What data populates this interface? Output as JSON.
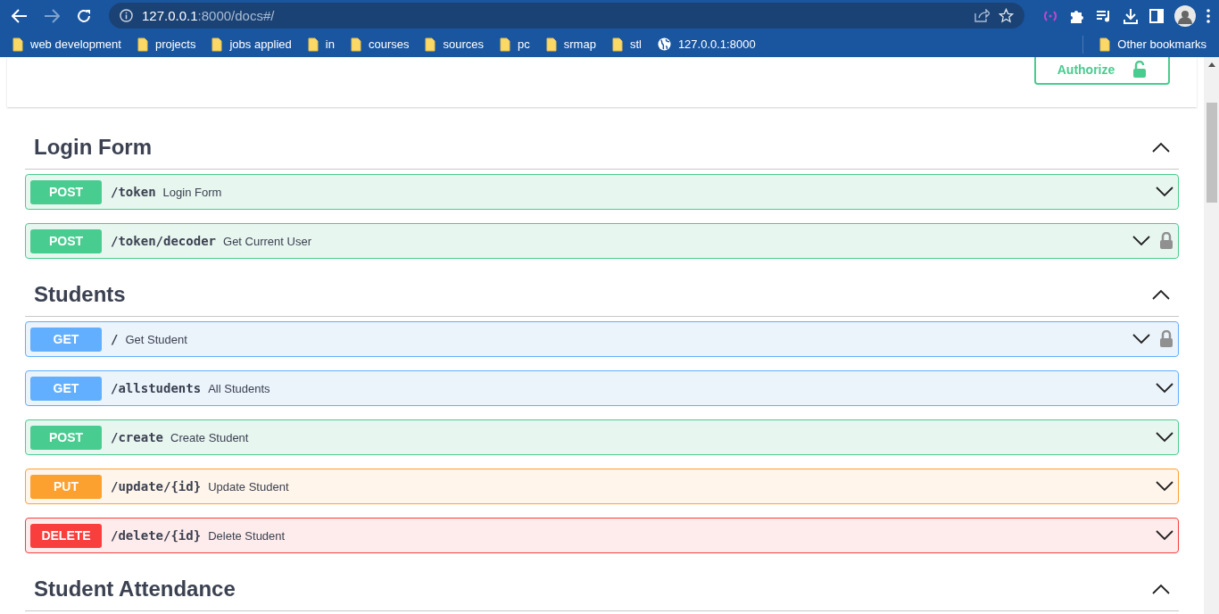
{
  "browser": {
    "address": {
      "host": "127.0.0.1",
      "rest": ":8000/docs#/"
    },
    "bookmarks": [
      {
        "kind": "folder",
        "label": "web development"
      },
      {
        "kind": "folder",
        "label": "projects"
      },
      {
        "kind": "folder",
        "label": "jobs applied"
      },
      {
        "kind": "folder",
        "label": "in"
      },
      {
        "kind": "folder",
        "label": "courses"
      },
      {
        "kind": "folder",
        "label": "sources"
      },
      {
        "kind": "folder",
        "label": "pc"
      },
      {
        "kind": "folder",
        "label": "srmap"
      },
      {
        "kind": "folder",
        "label": "stl"
      },
      {
        "kind": "site",
        "label": "127.0.0.1:8000"
      }
    ],
    "other_bookmarks": "Other bookmarks"
  },
  "authorize_button": {
    "label": "Authorize",
    "locked": false
  },
  "sections": [
    {
      "name": "Login Form",
      "expanded": true,
      "operations": [
        {
          "kind": "post",
          "method": "POST",
          "path": "/token",
          "summary": "Login Form",
          "locked": false
        },
        {
          "kind": "post",
          "method": "POST",
          "path": "/token/decoder",
          "summary": "Get Current User",
          "locked": true
        }
      ]
    },
    {
      "name": "Students",
      "expanded": true,
      "operations": [
        {
          "kind": "get",
          "method": "GET",
          "path": "/",
          "summary": "Get Student",
          "locked": true
        },
        {
          "kind": "get",
          "method": "GET",
          "path": "/allstudents",
          "summary": "All Students",
          "locked": false
        },
        {
          "kind": "post",
          "method": "POST",
          "path": "/create",
          "summary": "Create Student",
          "locked": false
        },
        {
          "kind": "put",
          "method": "PUT",
          "path": "/update/{id}",
          "summary": "Update Student",
          "locked": false
        },
        {
          "kind": "delete",
          "method": "DELETE",
          "path": "/delete/{id}",
          "summary": "Delete Student",
          "locked": false
        }
      ]
    },
    {
      "name": "Student Attendance",
      "expanded": true
    }
  ]
}
